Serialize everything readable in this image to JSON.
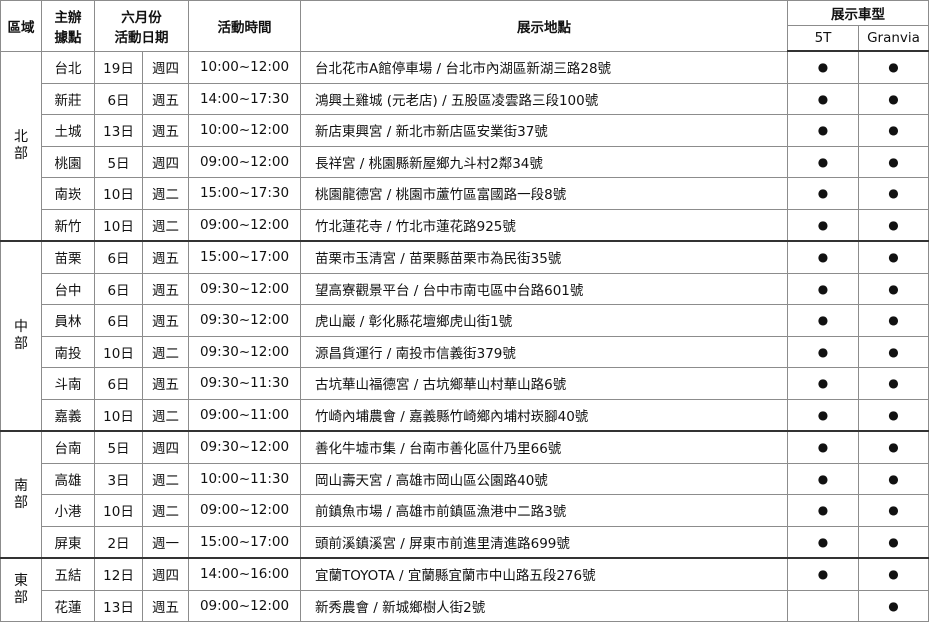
{
  "header": {
    "region": "區域",
    "organizer_line1": "主辦",
    "organizer_line2": "據點",
    "date_line1": "六月份",
    "date_line2": "活動日期",
    "time": "活動時間",
    "location": "展示地點",
    "models": "展示車型",
    "model_5t": "5T",
    "model_granvia": "Granvia"
  },
  "dot_symbol": "●",
  "groups": [
    {
      "region_chars": [
        "北",
        "部"
      ],
      "rows": [
        {
          "site": "台北",
          "date": "19日",
          "weekday": "週四",
          "time": "10:00~12:00",
          "location": "台北花市A館停車場 / 台北市內湖區新湖三路28號",
          "t5": true,
          "granvia": true
        },
        {
          "site": "新莊",
          "date": "6日",
          "weekday": "週五",
          "time": "14:00~17:30",
          "location": "鴻興土雞城 (元老店) / 五股區凌雲路三段100號",
          "t5": true,
          "granvia": true
        },
        {
          "site": "土城",
          "date": "13日",
          "weekday": "週五",
          "time": "10:00~12:00",
          "location": "新店東興宮 / 新北市新店區安業街37號",
          "t5": true,
          "granvia": true
        },
        {
          "site": "桃園",
          "date": "5日",
          "weekday": "週四",
          "time": "09:00~12:00",
          "location": "長祥宮 / 桃園縣新屋鄉九斗村2鄰34號",
          "t5": true,
          "granvia": true
        },
        {
          "site": "南崁",
          "date": "10日",
          "weekday": "週二",
          "time": "15:00~17:30",
          "location": "桃園龍德宮 / 桃園市蘆竹區富國路一段8號",
          "t5": true,
          "granvia": true
        },
        {
          "site": "新竹",
          "date": "10日",
          "weekday": "週二",
          "time": "09:00~12:00",
          "location": "竹北蓮花寺 / 竹北市蓮花路925號",
          "t5": true,
          "granvia": true
        }
      ]
    },
    {
      "region_chars": [
        "中",
        "部"
      ],
      "rows": [
        {
          "site": "苗栗",
          "date": "6日",
          "weekday": "週五",
          "time": "15:00~17:00",
          "location": "苗栗市玉清宮 / 苗栗縣苗栗市為民街35號",
          "t5": true,
          "granvia": true
        },
        {
          "site": "台中",
          "date": "6日",
          "weekday": "週五",
          "time": "09:30~12:00",
          "location": "望高寮觀景平台 / 台中市南屯區中台路601號",
          "t5": true,
          "granvia": true
        },
        {
          "site": "員林",
          "date": "6日",
          "weekday": "週五",
          "time": "09:30~12:00",
          "location": "虎山巖 / 彰化縣花壇鄉虎山街1號",
          "t5": true,
          "granvia": true
        },
        {
          "site": "南投",
          "date": "10日",
          "weekday": "週二",
          "time": "09:30~12:00",
          "location": "源昌貨運行 / 南投市信義街379號",
          "t5": true,
          "granvia": true
        },
        {
          "site": "斗南",
          "date": "6日",
          "weekday": "週五",
          "time": "09:30~11:30",
          "location": "古坑華山福德宮 / 古坑鄉華山村華山路6號",
          "t5": true,
          "granvia": true
        },
        {
          "site": "嘉義",
          "date": "10日",
          "weekday": "週二",
          "time": "09:00~11:00",
          "location": "竹崎內埔農會 / 嘉義縣竹崎鄉內埔村崁腳40號",
          "t5": true,
          "granvia": true
        }
      ]
    },
    {
      "region_chars": [
        "南",
        "部"
      ],
      "rows": [
        {
          "site": "台南",
          "date": "5日",
          "weekday": "週四",
          "time": "09:30~12:00",
          "location": "善化牛墟市集 / 台南市善化區什乃里66號",
          "t5": true,
          "granvia": true
        },
        {
          "site": "高雄",
          "date": "3日",
          "weekday": "週二",
          "time": "10:00~11:30",
          "location": "岡山壽天宮 / 高雄市岡山區公園路40號",
          "t5": true,
          "granvia": true
        },
        {
          "site": "小港",
          "date": "10日",
          "weekday": "週二",
          "time": "09:00~12:00",
          "location": "前鎮魚市場 / 高雄市前鎮區漁港中二路3號",
          "t5": true,
          "granvia": true
        },
        {
          "site": "屏東",
          "date": "2日",
          "weekday": "週一",
          "time": "15:00~17:00",
          "location": "頭前溪鎮溪宮 / 屏東市前進里清進路699號",
          "t5": true,
          "granvia": true
        }
      ]
    },
    {
      "region_chars": [
        "東",
        "部"
      ],
      "rows": [
        {
          "site": "五結",
          "date": "12日",
          "weekday": "週四",
          "time": "14:00~16:00",
          "location": "宜蘭TOYOTA / 宜蘭縣宜蘭市中山路五段276號",
          "t5": true,
          "granvia": true
        },
        {
          "site": "花蓮",
          "date": "13日",
          "weekday": "週五",
          "time": "09:00~12:00",
          "location": "新秀農會 / 新城鄉樹人街2號",
          "t5": false,
          "granvia": true
        }
      ]
    }
  ]
}
